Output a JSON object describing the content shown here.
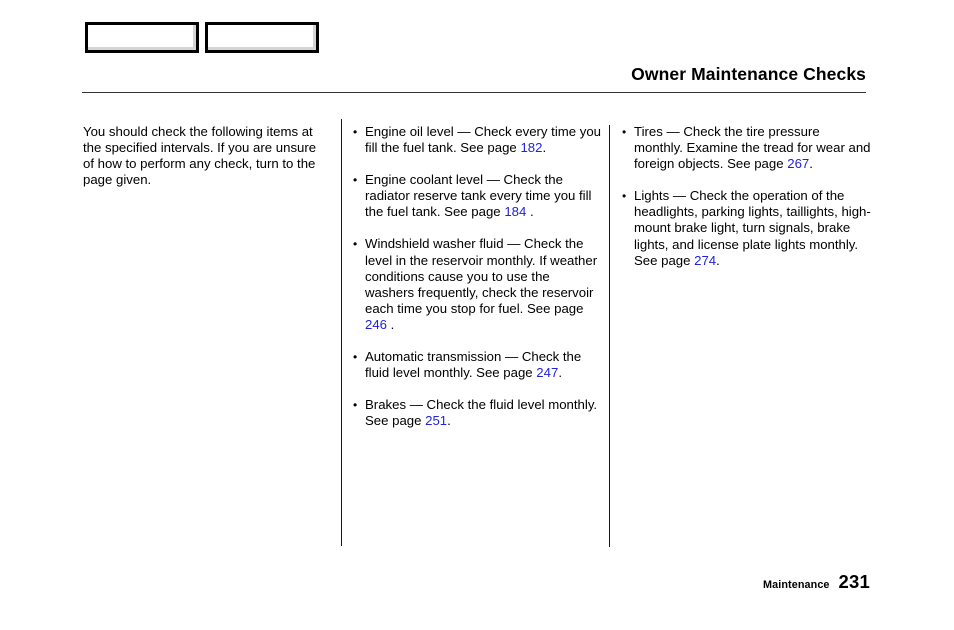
{
  "header": {
    "title": "Owner Maintenance Checks"
  },
  "tabs": [
    {
      "label": ""
    },
    {
      "label": ""
    }
  ],
  "colors": {
    "page_reference": "#2222dd",
    "rule": "#333333",
    "text": "#000000"
  },
  "left_column": {
    "intro": "You should check the following items at the specified intervals. If you are unsure of how to perform any check, turn to the page given."
  },
  "middle_column": {
    "items": [
      {
        "text": "Engine oil level — Check every time you fill the fuel tank. See page ",
        "page": "182",
        "suffix": "."
      },
      {
        "text": "Engine coolant level — Check the radiator reserve tank every time you fill the fuel tank. See page ",
        "page": "184",
        "suffix": " ."
      },
      {
        "text": "Windshield washer fluid — Check the level in the reservoir monthly. If weather conditions cause you to use the washers frequently, check the reservoir each time you stop for fuel. See page ",
        "page": "246",
        "suffix": " ."
      },
      {
        "text": "Automatic transmission — Check the fluid level monthly. See page ",
        "page": "247",
        "suffix": "."
      },
      {
        "text": "Brakes — Check the fluid level monthly. See page ",
        "page": "251",
        "suffix": "."
      }
    ]
  },
  "right_column": {
    "items": [
      {
        "text": "Tires — Check the tire pressure monthly. Examine the tread for wear and foreign objects. See page ",
        "page": "267",
        "suffix": "."
      },
      {
        "text": "Lights — Check the operation of the headlights, parking lights, taillights, high-mount brake light, turn signals, brake lights, and license plate lights monthly. See page ",
        "page": "274",
        "suffix": "."
      }
    ]
  },
  "footer": {
    "section": "Maintenance",
    "page_number": "231"
  }
}
